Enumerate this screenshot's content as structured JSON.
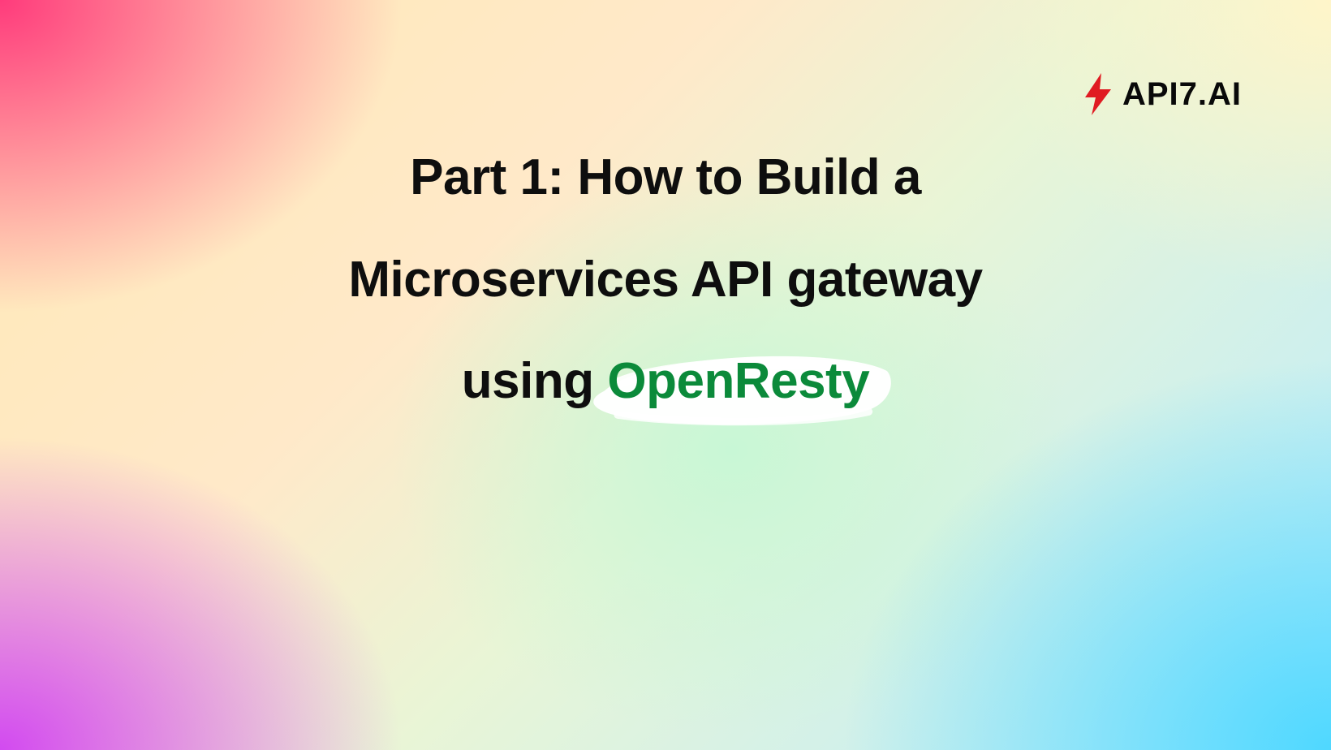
{
  "logo": {
    "text": "aPI7.aI",
    "bolt_color": "#e01b22"
  },
  "title": {
    "line1": "Part 1: How to Build a",
    "line2": "Microservices API gateway",
    "line3_prefix": "using ",
    "highlight": "OpenResty",
    "highlight_color": "#0b8a3a"
  }
}
